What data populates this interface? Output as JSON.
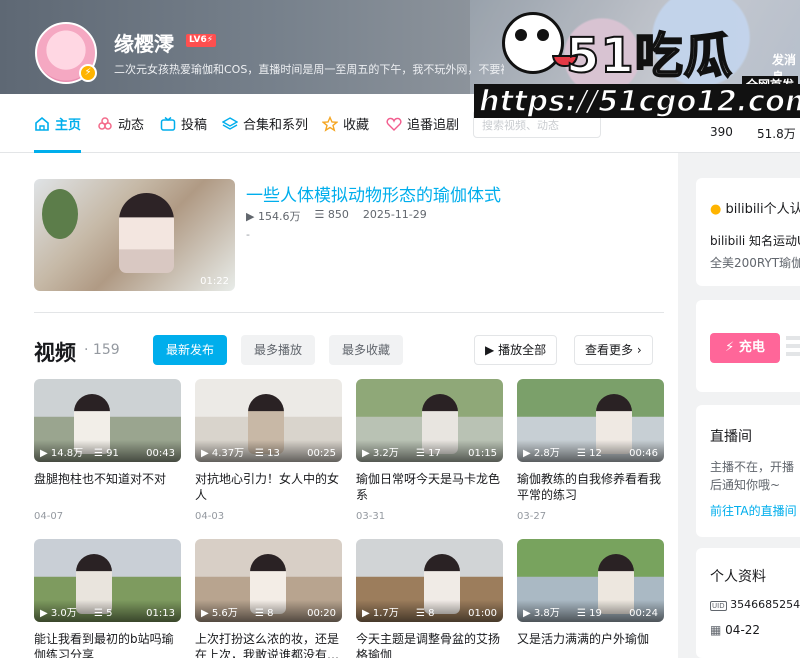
{
  "header": {
    "username": "缘樱澪",
    "level": "LV6⚡",
    "bio": "二次元女孩热爱瑜伽和COS，直播时间是周一至周五的下午，我不玩外网，不要被骗",
    "action_label": "发消息"
  },
  "watermark": {
    "logo": "51吃瓜",
    "tag": "全网首发",
    "url": "https://51cgo12.com"
  },
  "nav": {
    "tabs": [
      {
        "label": "主页",
        "icon": "home-icon",
        "active": true
      },
      {
        "label": "动态",
        "icon": "pinwheel-icon"
      },
      {
        "label": "投稿",
        "icon": "tv-icon"
      },
      {
        "label": "合集和系列",
        "icon": "layers-icon"
      },
      {
        "label": "收藏",
        "icon": "star-icon"
      },
      {
        "label": "追番追剧",
        "icon": "heart-icon"
      }
    ],
    "search_placeholder": "搜索视频、动态",
    "stats": [
      "390",
      "51.8万"
    ]
  },
  "featured": {
    "title": "一些人体模拟动物形态的瑜伽体式",
    "plays": "154.6万",
    "comments": "850",
    "date": "2025-11-29",
    "desc": "-",
    "duration": "01:22"
  },
  "videos": {
    "title": "视频",
    "count": "159",
    "sort_tabs": [
      "最新发布",
      "最多播放",
      "最多收藏"
    ],
    "play_all": "播放全部",
    "more": "查看更多",
    "items": [
      {
        "plays": "14.8万",
        "comments": "91",
        "duration": "00:43",
        "title": "盘腿抱柱也不知道对不对",
        "date": "04-07"
      },
      {
        "plays": "4.37万",
        "comments": "13",
        "duration": "00:25",
        "title": "对抗地心引力！女人中的女人",
        "date": "04-03"
      },
      {
        "plays": "3.2万",
        "comments": "17",
        "duration": "01:15",
        "title": "瑜伽日常呀今天是马卡龙色系",
        "date": "03-31"
      },
      {
        "plays": "2.8万",
        "comments": "12",
        "duration": "00:46",
        "title": "瑜伽教练的自我修养看看我平常的练习",
        "date": "03-27"
      },
      {
        "plays": "3.0万",
        "comments": "5",
        "duration": "01:13",
        "title": "能让我看到最初的b站吗瑜伽练习分享",
        "date": ""
      },
      {
        "plays": "5.6万",
        "comments": "8",
        "duration": "00:20",
        "title": "上次打扮这么浓的妆，还是在上次，我敢说谁都没有…",
        "date": ""
      },
      {
        "plays": "1.7万",
        "comments": "8",
        "duration": "01:00",
        "title": "今天主题是调整骨盆的艾扬格瑜伽",
        "date": ""
      },
      {
        "plays": "3.8万",
        "comments": "19",
        "duration": "00:24",
        "title": "又是活力满满的户外瑜伽",
        "date": ""
      }
    ]
  },
  "sidebar": {
    "verify_title": "bilibili个人认证",
    "verify_line1": "bilibili 知名运动UP主",
    "verify_line2": "全美200RYT瑜伽",
    "charge": "充电",
    "live_title": "直播间",
    "live_status": "主播不在，开播后通知你哦~",
    "live_link": "前往TA的直播间",
    "profile_title": "个人资料",
    "uid": "3546685254",
    "birthday": "04-22"
  },
  "colors": {
    "accent": "#00aeec",
    "charge": "#ff6699"
  }
}
